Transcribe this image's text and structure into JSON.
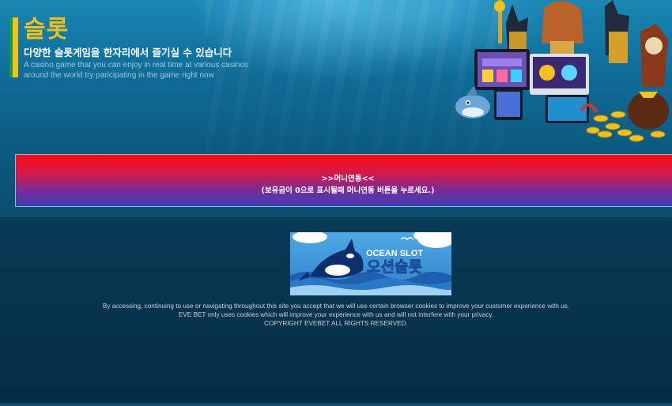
{
  "header": {
    "title": "슬롯",
    "subtitle": "다양한 슬롯게임을 한자리에서 즐기실 수 있습니다",
    "description_line1": "A casino game that you can enjoy in real time at various casinos",
    "description_line2": "around the world try paricipating in the game right now"
  },
  "money_button": {
    "line1": ">>머니연동<<",
    "line2": "(보유금이 0으로 표시될때 머니연동 버튼을 누르세요.)"
  },
  "game_logo": {
    "en": "OCEAN SLOT",
    "ko": "오션슬롯"
  },
  "footer": {
    "line1": "By accessing, continuing to use or navigating throughout this site you accept that we will use certain browser cookies to improve your customer experience with us.",
    "line2": "EVE BET only uses cookies which will improve your experience with us and will not interfere with your privacy.",
    "line3": "COPYRIGHT EVEBET ALL RIGHTS RESERVED."
  },
  "colors": {
    "accent_yellow": "#f2c21a",
    "accent_green": "#1e9a3e",
    "banner_top": "#ff0a12",
    "banner_bottom": "#3e3db0"
  }
}
